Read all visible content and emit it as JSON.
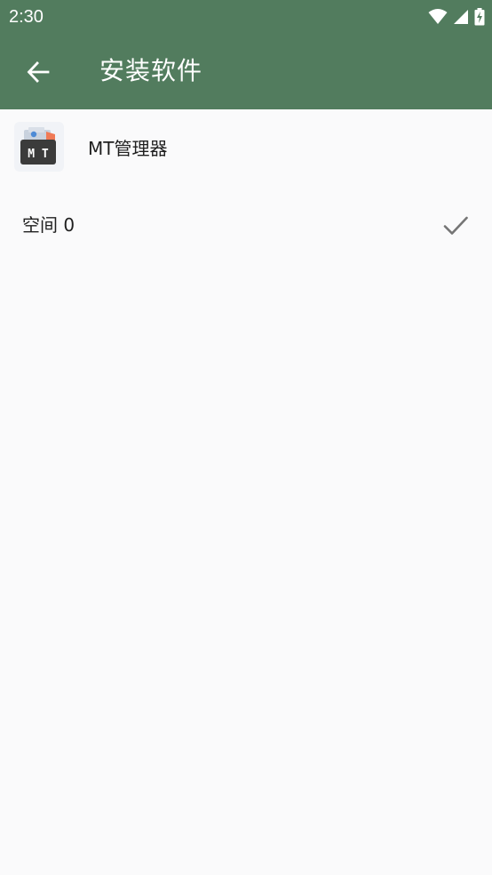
{
  "status_bar": {
    "time": "2:30",
    "icons": [
      "wifi-icon",
      "cell-signal-icon",
      "battery-charging-icon"
    ]
  },
  "app_bar": {
    "back_icon": "arrow-left-icon",
    "title": "安装软件",
    "color": "#527c5e"
  },
  "app": {
    "icon": "mt-manager-app-icon",
    "icon_label": "M T",
    "name": "MT管理器"
  },
  "space": {
    "label": "空间 0",
    "selected": true,
    "selected_icon": "checkmark-icon"
  },
  "colors": {
    "background": "#fafafb",
    "text_primary": "#1f1f1f",
    "check": "#757575"
  }
}
